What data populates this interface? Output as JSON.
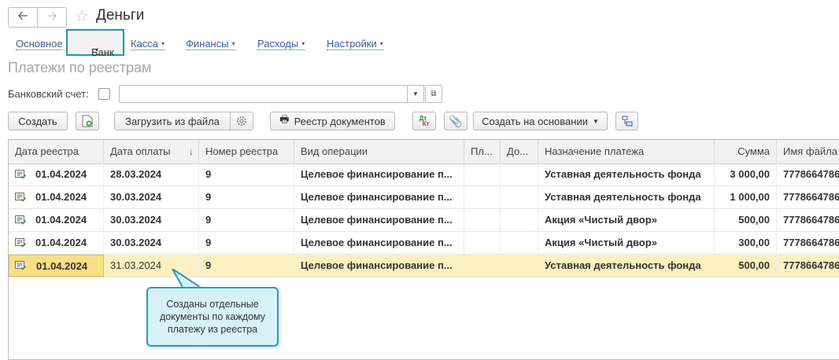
{
  "window": {
    "title": "Деньги"
  },
  "menu": {
    "items": [
      {
        "label": "Основное",
        "has_arrow": false
      },
      {
        "label": "Банк",
        "has_arrow": true
      },
      {
        "label": "Касса",
        "has_arrow": true
      },
      {
        "label": "Финансы",
        "has_arrow": true
      },
      {
        "label": "Расходы",
        "has_arrow": true
      },
      {
        "label": "Настройки",
        "has_arrow": true
      }
    ],
    "arrow": "▾"
  },
  "page": {
    "subtitle": "Платежи по реестрам"
  },
  "filter": {
    "bank_account_label": "Банковский счет:",
    "bank_account_value": ""
  },
  "toolbar": {
    "create": "Создать",
    "upload": "Загрузить из файла",
    "registry": "Реестр документов",
    "create_based": "Создать на основании",
    "dtkt_top": "Дт",
    "dtkt_bottom": "Кт"
  },
  "table": {
    "columns": [
      "Дата реестра",
      "Дата оплаты",
      "Номер реестра",
      "Вид операции",
      "Пл...",
      "До...",
      "Назначение платежа",
      "Сумма",
      "Имя файла"
    ],
    "sort_indicator": "↓",
    "rows": [
      {
        "registry_date": "01.04.2024",
        "pay_date": "28.03.2024",
        "number": "9",
        "operation": "Целевое финансирование п...",
        "pl": "",
        "do": "",
        "purpose": "Уставная деятельность фонда",
        "sum": "3 000,00",
        "file": "7778664786"
      },
      {
        "registry_date": "01.04.2024",
        "pay_date": "30.03.2024",
        "number": "9",
        "operation": "Целевое финансирование п...",
        "pl": "",
        "do": "",
        "purpose": "Уставная деятельность фонда",
        "sum": "1 000,00",
        "file": "7778664786"
      },
      {
        "registry_date": "01.04.2024",
        "pay_date": "30.03.2024",
        "number": "9",
        "operation": "Целевое финансирование п...",
        "pl": "",
        "do": "",
        "purpose": "Акция «Чистый двор»",
        "sum": "500,00",
        "file": "7778664786"
      },
      {
        "registry_date": "01.04.2024",
        "pay_date": "30.03.2024",
        "number": "9",
        "operation": "Целевое финансирование п...",
        "pl": "",
        "do": "",
        "purpose": "Акция «Чистый двор»",
        "sum": "300,00",
        "file": "7778664786"
      },
      {
        "registry_date": "01.04.2024",
        "pay_date": "31.03.2024",
        "number": "9",
        "operation": "Целевое финансирование п...",
        "pl": "",
        "do": "",
        "purpose": "Уставная деятельность фонда",
        "sum": "500,00",
        "file": "7778664786",
        "selected": true
      }
    ]
  },
  "callout": {
    "text_lines": [
      "Созданы отдельные",
      "документы по каждому",
      "платежу из реестра"
    ]
  },
  "colors": {
    "accent": "#2496b5",
    "link": "#3a5da8",
    "selected_row": "#fcefc0",
    "callout_bg": "#d8f0f7"
  }
}
